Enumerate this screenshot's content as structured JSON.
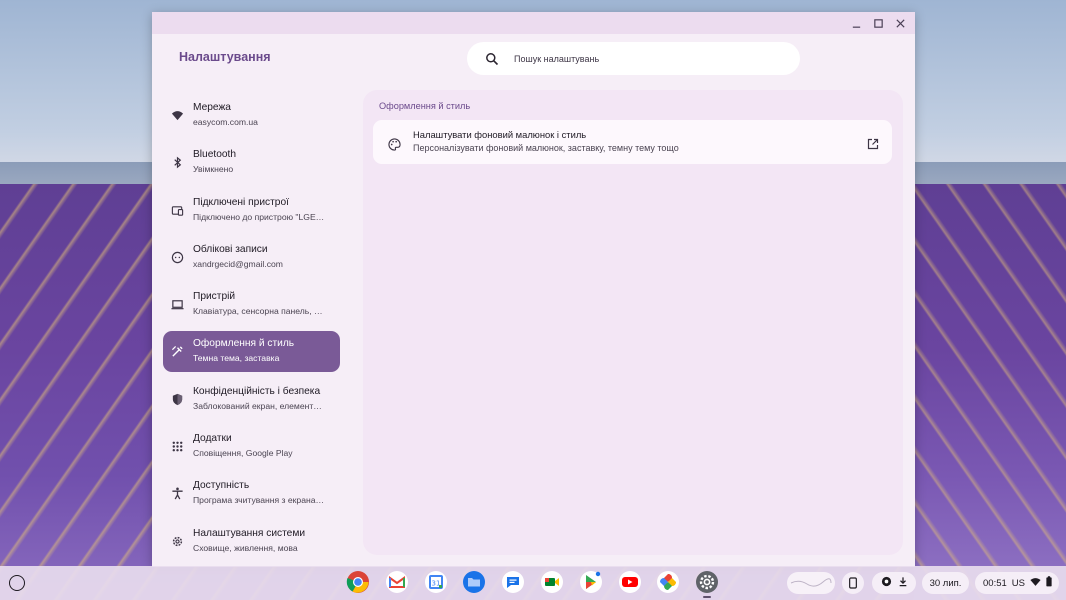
{
  "window": {
    "app_title": "Налаштування",
    "search_placeholder": "Пошук налаштувань",
    "controls": [
      "minimize-icon",
      "maximize-icon",
      "close-icon"
    ]
  },
  "sidebar": {
    "items": [
      {
        "label": "Мережа",
        "sub": "easycom.com.ua",
        "icon": "wifi-icon",
        "active": false
      },
      {
        "label": "Bluetooth",
        "sub": "Увімкнено",
        "icon": "bluetooth-icon",
        "active": false
      },
      {
        "label": "Підключені пристрої",
        "sub": "Підключено до пристрою \"LGE…",
        "icon": "connected-devices-icon",
        "active": false
      },
      {
        "label": "Облікові записи",
        "sub": "xandrgecid@gmail.com",
        "icon": "face-icon",
        "active": false
      },
      {
        "label": "Пристрій",
        "sub": "Клавіатура, сенсорна панель, …",
        "icon": "laptop-icon",
        "active": false
      },
      {
        "label": "Оформлення й стиль",
        "sub": "Темна тема, заставка",
        "icon": "paint-brush-icon",
        "active": true
      },
      {
        "label": "Конфіденційність і безпека",
        "sub": "Заблокований екран, елемент…",
        "icon": "shield-icon",
        "active": false
      },
      {
        "label": "Додатки",
        "sub": "Сповіщення, Google Play",
        "icon": "apps-grid-icon",
        "active": false
      },
      {
        "label": "Доступність",
        "sub": "Програма зчитування з екрана…",
        "icon": "accessibility-icon",
        "active": false
      },
      {
        "label": "Налаштування системи",
        "sub": "Сховище, живлення, мова",
        "icon": "gear-icon",
        "active": false
      }
    ]
  },
  "main": {
    "section_title": "Оформлення й стиль",
    "card": {
      "title": "Налаштувати фоновий малюнок і стиль",
      "subtitle": "Персоналізувати фоновий малюнок, заставку, темну тему тощо",
      "icon": "palette-icon",
      "action_icon": "open-external-icon"
    }
  },
  "shelf": {
    "apps": [
      "chrome-icon",
      "gmail-icon",
      "calendar-icon",
      "files-icon",
      "messages-icon",
      "meet-icon",
      "play-store-icon",
      "youtube-icon",
      "photos-icon",
      "settings-app-icon"
    ],
    "date": "30 лип.",
    "time": "00:51",
    "locale": "US",
    "colors": {
      "accent": "#7a5a97",
      "title": "#6b4a8c"
    }
  }
}
